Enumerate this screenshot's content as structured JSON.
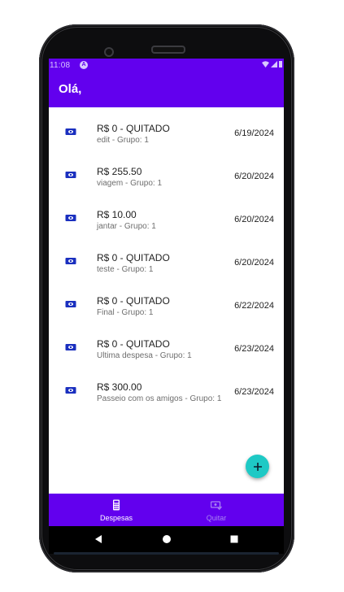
{
  "status_bar": {
    "time": "11:08"
  },
  "app_bar": {
    "title": "Olá,"
  },
  "expenses": [
    {
      "amount": "R$ 0 - QUITADO",
      "description": "edit - Grupo: 1",
      "date": "6/19/2024"
    },
    {
      "amount": "R$ 255.50",
      "description": "viagem - Grupo: 1",
      "date": "6/20/2024"
    },
    {
      "amount": "R$ 10.00",
      "description": "jantar - Grupo: 1",
      "date": "6/20/2024"
    },
    {
      "amount": "R$ 0 - QUITADO",
      "description": "teste - Grupo: 1",
      "date": "6/20/2024"
    },
    {
      "amount": "R$ 0 - QUITADO",
      "description": "Final - Grupo: 1",
      "date": "6/22/2024"
    },
    {
      "amount": "R$ 0 - QUITADO",
      "description": "Ultima despesa - Grupo: 1",
      "date": "6/23/2024"
    },
    {
      "amount": "R$ 300.00",
      "description": "Passeio com os amigos - Grupo: 1",
      "date": "6/23/2024"
    }
  ],
  "fab": {
    "icon": "plus-icon"
  },
  "bottom_nav": {
    "items": [
      {
        "label": "Despesas",
        "icon": "calculator-icon",
        "selected": true
      },
      {
        "label": "Quitar",
        "icon": "money-check-icon",
        "selected": false
      }
    ]
  },
  "colors": {
    "primary": "#6200ee",
    "fab": "#1ec9c5",
    "row_icon": "#1a2fbf",
    "nav_inactive": "#a985f2"
  }
}
